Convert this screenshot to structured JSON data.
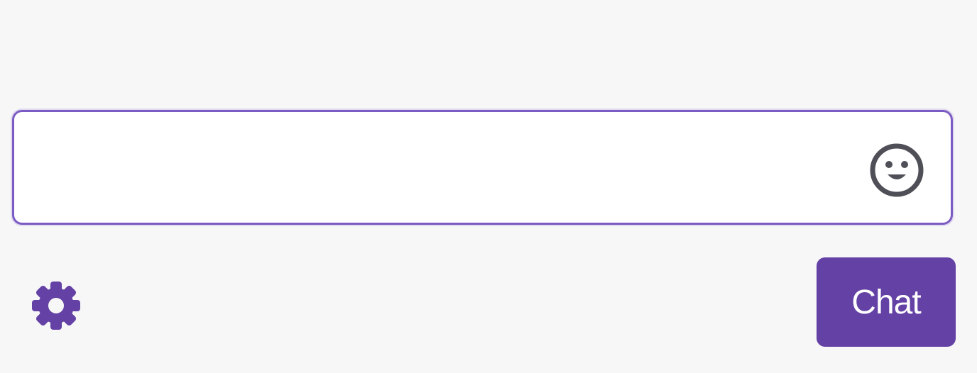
{
  "chat": {
    "input": {
      "value": "",
      "placeholder": ""
    },
    "send_label": "Chat"
  },
  "icons": {
    "emote": "smiley-icon",
    "settings": "gear-icon"
  },
  "colors": {
    "accent": "#6441a5",
    "input_border": "#7c5cc4",
    "icon_gray": "#4f4f57",
    "background": "#f7f7f8"
  }
}
